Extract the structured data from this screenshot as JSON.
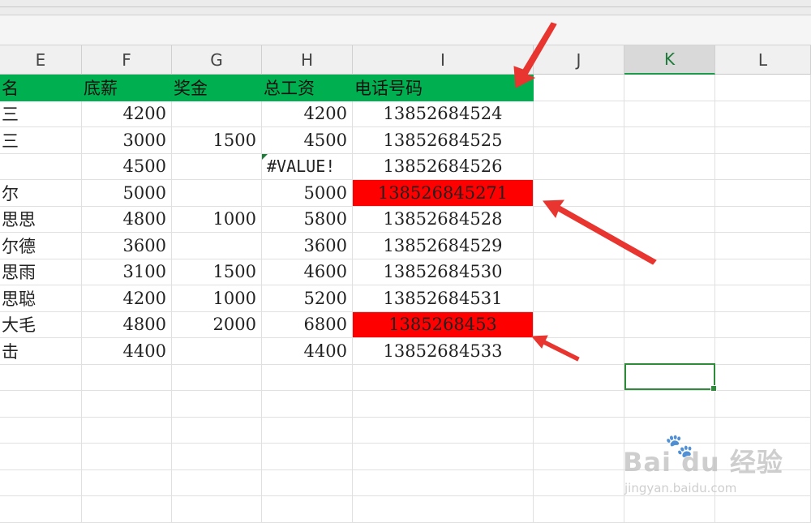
{
  "columns": [
    {
      "letter": "E",
      "active": false
    },
    {
      "letter": "F",
      "active": false
    },
    {
      "letter": "G",
      "active": false
    },
    {
      "letter": "H",
      "active": false
    },
    {
      "letter": "I",
      "active": false
    },
    {
      "letter": "J",
      "active": false
    },
    {
      "letter": "K",
      "active": true
    },
    {
      "letter": "L",
      "active": false
    }
  ],
  "header_row": {
    "name": "名",
    "base_salary": "底薪",
    "bonus": "奖金",
    "total_salary": "总工资",
    "phone": "电话号码"
  },
  "rows": [
    {
      "name": "三",
      "base": "4200",
      "bonus": "",
      "total": "4200",
      "phone": "13852684524",
      "highlight": false,
      "error": false
    },
    {
      "name": "三",
      "base": "3000",
      "bonus": "1500",
      "total": "4500",
      "phone": "13852684525",
      "highlight": false,
      "error": false
    },
    {
      "name": "",
      "base": "4500",
      "bonus": "",
      "total": "#VALUE!",
      "phone": "13852684526",
      "highlight": false,
      "error": true
    },
    {
      "name": "尔",
      "base": "5000",
      "bonus": "",
      "total": "5000",
      "phone": "138526845271",
      "highlight": true,
      "error": false
    },
    {
      "name": "思思",
      "base": "4800",
      "bonus": "1000",
      "total": "5800",
      "phone": "13852684528",
      "highlight": false,
      "error": false
    },
    {
      "name": "尔德",
      "base": "3600",
      "bonus": "",
      "total": "3600",
      "phone": "13852684529",
      "highlight": false,
      "error": false
    },
    {
      "name": "思雨",
      "base": "3100",
      "bonus": "1500",
      "total": "4600",
      "phone": "13852684530",
      "highlight": false,
      "error": false
    },
    {
      "name": "思聪",
      "base": "4200",
      "bonus": "1000",
      "total": "5200",
      "phone": "13852684531",
      "highlight": false,
      "error": false
    },
    {
      "name": "大毛",
      "base": "4800",
      "bonus": "2000",
      "total": "6800",
      "phone": "1385268453",
      "highlight": true,
      "error": false
    },
    {
      "name": "击",
      "base": "4400",
      "bonus": "",
      "total": "4400",
      "phone": "13852684533",
      "highlight": false,
      "error": false
    }
  ],
  "colors": {
    "header_fill": "#00b050",
    "highlight_fill": "#ff0000",
    "arrow": "#e8352f",
    "selection": "#2e8b3a"
  },
  "watermark": {
    "logo": "Bai du 经验",
    "site": "jingyan.baidu.com"
  }
}
